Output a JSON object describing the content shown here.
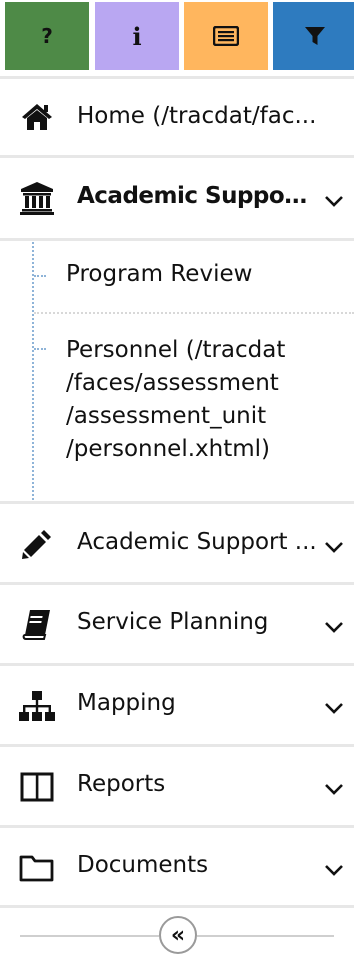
{
  "toolbar": {
    "help": {
      "label": "?",
      "color": "#4e8a47"
    },
    "info": {
      "label": "i",
      "color": "#b9a7f2"
    },
    "card": {
      "icon": "card-list-icon",
      "color": "#ffb65e"
    },
    "filter": {
      "icon": "filter-icon",
      "color": "#2e7bbf"
    }
  },
  "nav": {
    "home": {
      "label": "Home (/tracdat/fac...",
      "icon": "home-icon"
    },
    "academic_support_unit": {
      "label": "Academic Support...",
      "icon": "university-icon"
    },
    "sub_items": [
      {
        "lines": [
          "Program Review"
        ]
      },
      {
        "lines": [
          "Personnel (/tracdat",
          "/faces/assessment",
          "/assessment_unit",
          "/personnel.xhtml)"
        ]
      }
    ],
    "academic_support_2": {
      "label": "Academic Support ...",
      "icon": "pencil-icon"
    },
    "service_planning": {
      "label": "Service Planning",
      "icon": "book-icon"
    },
    "mapping": {
      "label": "Mapping",
      "icon": "sitemap-icon"
    },
    "reports": {
      "label": "Reports",
      "icon": "columns-icon"
    },
    "documents": {
      "label": "Documents",
      "icon": "folder-icon"
    }
  },
  "collapse": {
    "label": "«"
  }
}
